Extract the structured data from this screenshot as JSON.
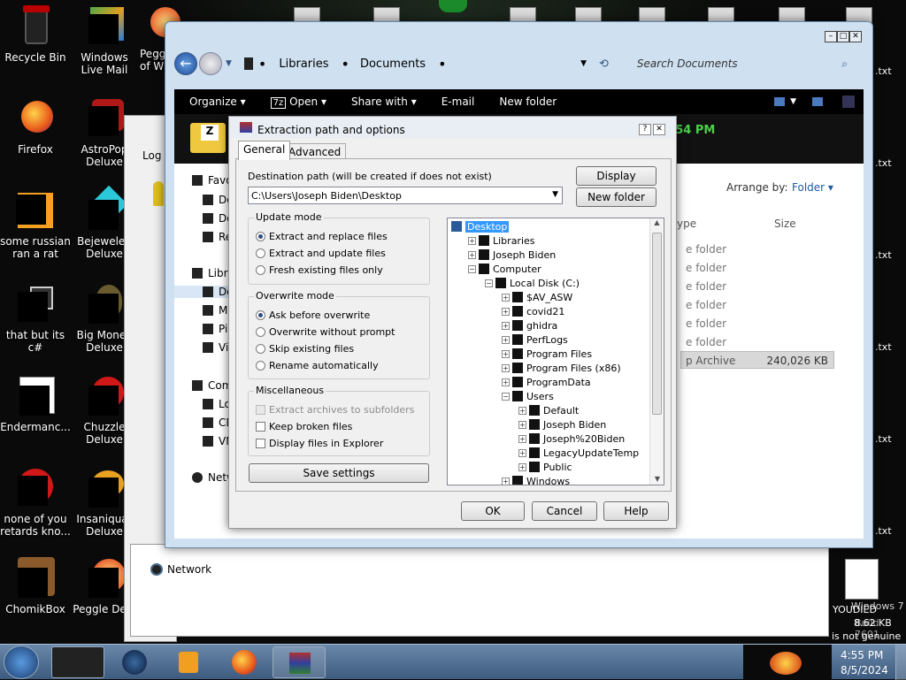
{
  "desktop": {
    "icons_left": [
      {
        "label": "Recycle Bin",
        "icon": "recycle-bin-icon"
      },
      {
        "label": "Firefox",
        "icon": "firefox-icon"
      },
      {
        "label": "some russian ran a rat",
        "icon": "e-icon"
      },
      {
        "label": "that but its c#",
        "icon": "windows-stack-icon"
      },
      {
        "label": "Endermanc...",
        "icon": "document-icon"
      },
      {
        "label": "none of you retards kno...",
        "icon": "app-icon"
      },
      {
        "label": "ChomikBox",
        "icon": "chomikbox-icon"
      }
    ],
    "icons_col2": [
      {
        "label": "Windows Live Mail",
        "icon": "mail-icon"
      },
      {
        "label": "AstroPop Deluxe",
        "icon": "game-icon"
      },
      {
        "label": "Bejeweled Deluxe",
        "icon": "gem-icon"
      },
      {
        "label": "Big Money Deluxe",
        "icon": "money-icon"
      },
      {
        "label": "Chuzzle Deluxe",
        "icon": "chuzzle-icon"
      },
      {
        "label": "Insaniquar Deluxe",
        "icon": "fish-icon"
      },
      {
        "label": "Peggle Delu",
        "icon": "peggle-icon"
      }
    ],
    "col3_partial": "Pegg of W",
    "right_files": [
      ".txt",
      ".txt",
      ".txt",
      ".txt",
      ".txt",
      ".txt",
      ".txt",
      ".txt",
      ".txt"
    ],
    "watermark": {
      "line1": "Windows 7",
      "line2": "Build 7601",
      "line3": "is not genuine",
      "overlay1": "YOUDIED",
      "overlay2": "8.62 KB"
    }
  },
  "explorer": {
    "breadcrumb": [
      "Libraries",
      "Documents"
    ],
    "search_placeholder": "Search Documents",
    "toolbar": [
      "Organize",
      "Open",
      "Share with",
      "E-mail",
      "New folder"
    ],
    "clock_fragment": ":54 PM",
    "arrange_label": "Arrange by:",
    "arrange_value": "Folder",
    "columns": {
      "type": "ype",
      "size": "Size"
    },
    "rows": [
      "e folder",
      "e folder",
      "e folder",
      "e folder",
      "e folder",
      "e folder"
    ],
    "archive_row": {
      "type": "p Archive",
      "size": "240,026 KB"
    },
    "nav": [
      "Favo",
      "De",
      "Do",
      "Re",
      "Libra",
      "Do",
      "Mu",
      "Pic",
      "Vid",
      "Com",
      "Lo",
      "CD",
      "VM",
      "Netw"
    ],
    "log_label": "Log C",
    "network_label": "Network"
  },
  "dialog": {
    "title": "Extraction path and options",
    "tabs": [
      "General",
      "Advanced"
    ],
    "dest_label": "Destination path (will be created if does not exist)",
    "dest_value": "C:\\Users\\Joseph Biden\\Desktop",
    "btn_display": "Display",
    "btn_new_folder": "New folder",
    "update_mode": {
      "title": "Update mode",
      "options": [
        "Extract and replace files",
        "Extract and update files",
        "Fresh existing files only"
      ],
      "selected": 0
    },
    "overwrite_mode": {
      "title": "Overwrite mode",
      "options": [
        "Ask before overwrite",
        "Overwrite without prompt",
        "Skip existing files",
        "Rename automatically"
      ],
      "selected": 0
    },
    "misc": {
      "title": "Miscellaneous",
      "options": [
        "Extract archives to subfolders",
        "Keep broken files",
        "Display files in Explorer"
      ]
    },
    "btn_save": "Save settings",
    "tree": [
      {
        "label": "Desktop",
        "level": 0
      },
      {
        "label": "Libraries",
        "level": 1
      },
      {
        "label": "Joseph Biden",
        "level": 1
      },
      {
        "label": "Computer",
        "level": 1
      },
      {
        "label": "Local Disk (C:)",
        "level": 2
      },
      {
        "label": "$AV_ASW",
        "level": 3
      },
      {
        "label": "covid21",
        "level": 3
      },
      {
        "label": "ghidra",
        "level": 3
      },
      {
        "label": "PerfLogs",
        "level": 3
      },
      {
        "label": "Program Files",
        "level": 3
      },
      {
        "label": "Program Files (x86)",
        "level": 3
      },
      {
        "label": "ProgramData",
        "level": 3
      },
      {
        "label": "Users",
        "level": 3
      },
      {
        "label": "Default",
        "level": 4
      },
      {
        "label": "Joseph Biden",
        "level": 4
      },
      {
        "label": "Joseph%20Biden",
        "level": 4
      },
      {
        "label": "LegacyUpdateTemp",
        "level": 4
      },
      {
        "label": "Public",
        "level": 4
      },
      {
        "label": "Windows",
        "level": 3
      }
    ],
    "btn_ok": "OK",
    "btn_cancel": "Cancel",
    "btn_help": "Help"
  },
  "taskbar": {
    "time": "4:55 PM",
    "date": "8/5/2024"
  },
  "colors": {
    "accent": "#3d5b7e",
    "tree_selected": "#3399ff"
  }
}
